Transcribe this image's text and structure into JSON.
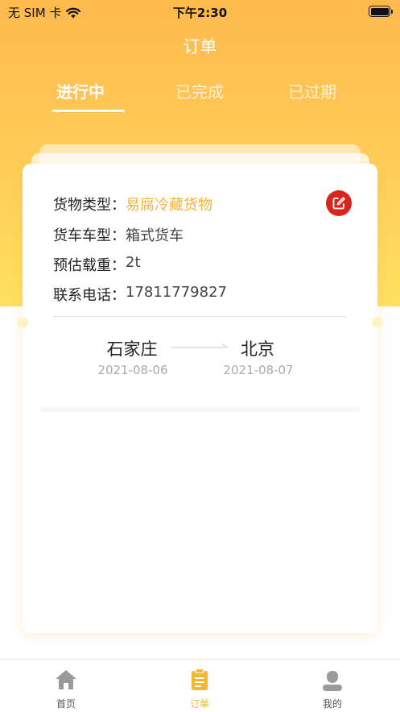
{
  "status_bar": {
    "carrier": "无 SIM 卡",
    "time": "下午2:30"
  },
  "page": {
    "title": "订单"
  },
  "tabs": [
    {
      "label": "进行中",
      "active": true
    },
    {
      "label": "已完成",
      "active": false
    },
    {
      "label": "已过期",
      "active": false
    }
  ],
  "order": {
    "cargo_type_label": "货物类型：",
    "cargo_type_value": "易腐冷藏货物",
    "truck_type_label": "货车车型：",
    "truck_type_value": "箱式货车",
    "load_label": "预估载重：",
    "load_value": "2t",
    "phone_label": "联系电话：",
    "phone_value": "17811779827",
    "origin_city": "石家庄",
    "origin_date": "2021-08-06",
    "destination_city": "北京",
    "destination_date": "2021-08-07"
  },
  "tabbar": [
    {
      "label": "首页",
      "icon": "home-icon",
      "active": false
    },
    {
      "label": "订单",
      "icon": "clipboard-icon",
      "active": true
    },
    {
      "label": "我的",
      "icon": "user-icon",
      "active": false
    }
  ],
  "colors": {
    "accent": "#f5b632",
    "header_top": "#ffb94e",
    "header_bottom": "#ffe060",
    "edit_red": "#d9251c",
    "highlight_value": "#f2b23a"
  }
}
